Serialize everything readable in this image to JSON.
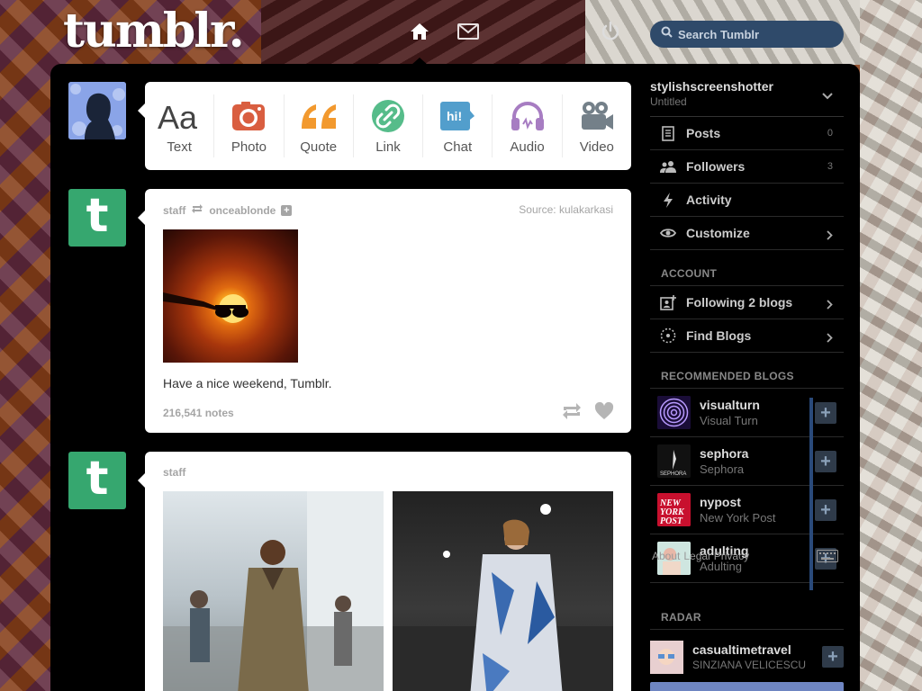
{
  "header": {
    "logo": "tumblr.",
    "search_placeholder": "Search Tumblr"
  },
  "post_types": [
    {
      "label": "Text",
      "icon": "text-icon",
      "color": "#444444"
    },
    {
      "label": "Photo",
      "icon": "camera-icon",
      "color": "#d95e40"
    },
    {
      "label": "Quote",
      "icon": "quote-icon",
      "color": "#f2992e"
    },
    {
      "label": "Link",
      "icon": "link-icon",
      "color": "#56bc8a"
    },
    {
      "label": "Chat",
      "icon": "chat-icon",
      "color": "#529ecc"
    },
    {
      "label": "Audio",
      "icon": "headphones-icon",
      "color": "#a77dc2"
    },
    {
      "label": "Video",
      "icon": "video-camera-icon",
      "color": "#748089"
    }
  ],
  "post1": {
    "author": "staff",
    "reblogged_from": "onceablonde",
    "source_label": "Source:",
    "source": "kulakarkasi",
    "caption": "Have a nice weekend, Tumblr.",
    "notes": "216,541 notes"
  },
  "post2": {
    "author": "staff"
  },
  "sidebar": {
    "blog_name": "stylishscreenshotter",
    "blog_title": "Untitled",
    "items": [
      {
        "label": "Posts",
        "count": "0"
      },
      {
        "label": "Followers",
        "count": "3"
      },
      {
        "label": "Activity"
      },
      {
        "label": "Customize"
      }
    ],
    "account_heading": "ACCOUNT",
    "account_items": [
      {
        "label": "Following 2 blogs"
      },
      {
        "label": "Find Blogs"
      }
    ],
    "recommended_heading": "RECOMMENDED BLOGS",
    "recommended": [
      {
        "name": "visualturn",
        "title": "Visual Turn"
      },
      {
        "name": "sephora",
        "title": "Sephora",
        "avatar_text": "SEPHORA"
      },
      {
        "name": "nypost",
        "title": "New York Post",
        "avatar_text": "NEW YORK POST"
      },
      {
        "name": "adulting",
        "title": "Adulting"
      }
    ],
    "footer": [
      "About",
      "Legal",
      "Privacy"
    ],
    "radar_heading": "RADAR",
    "radar": {
      "name": "casualtimetravel",
      "subtitle": "SINZIANA VELICESCU"
    }
  }
}
